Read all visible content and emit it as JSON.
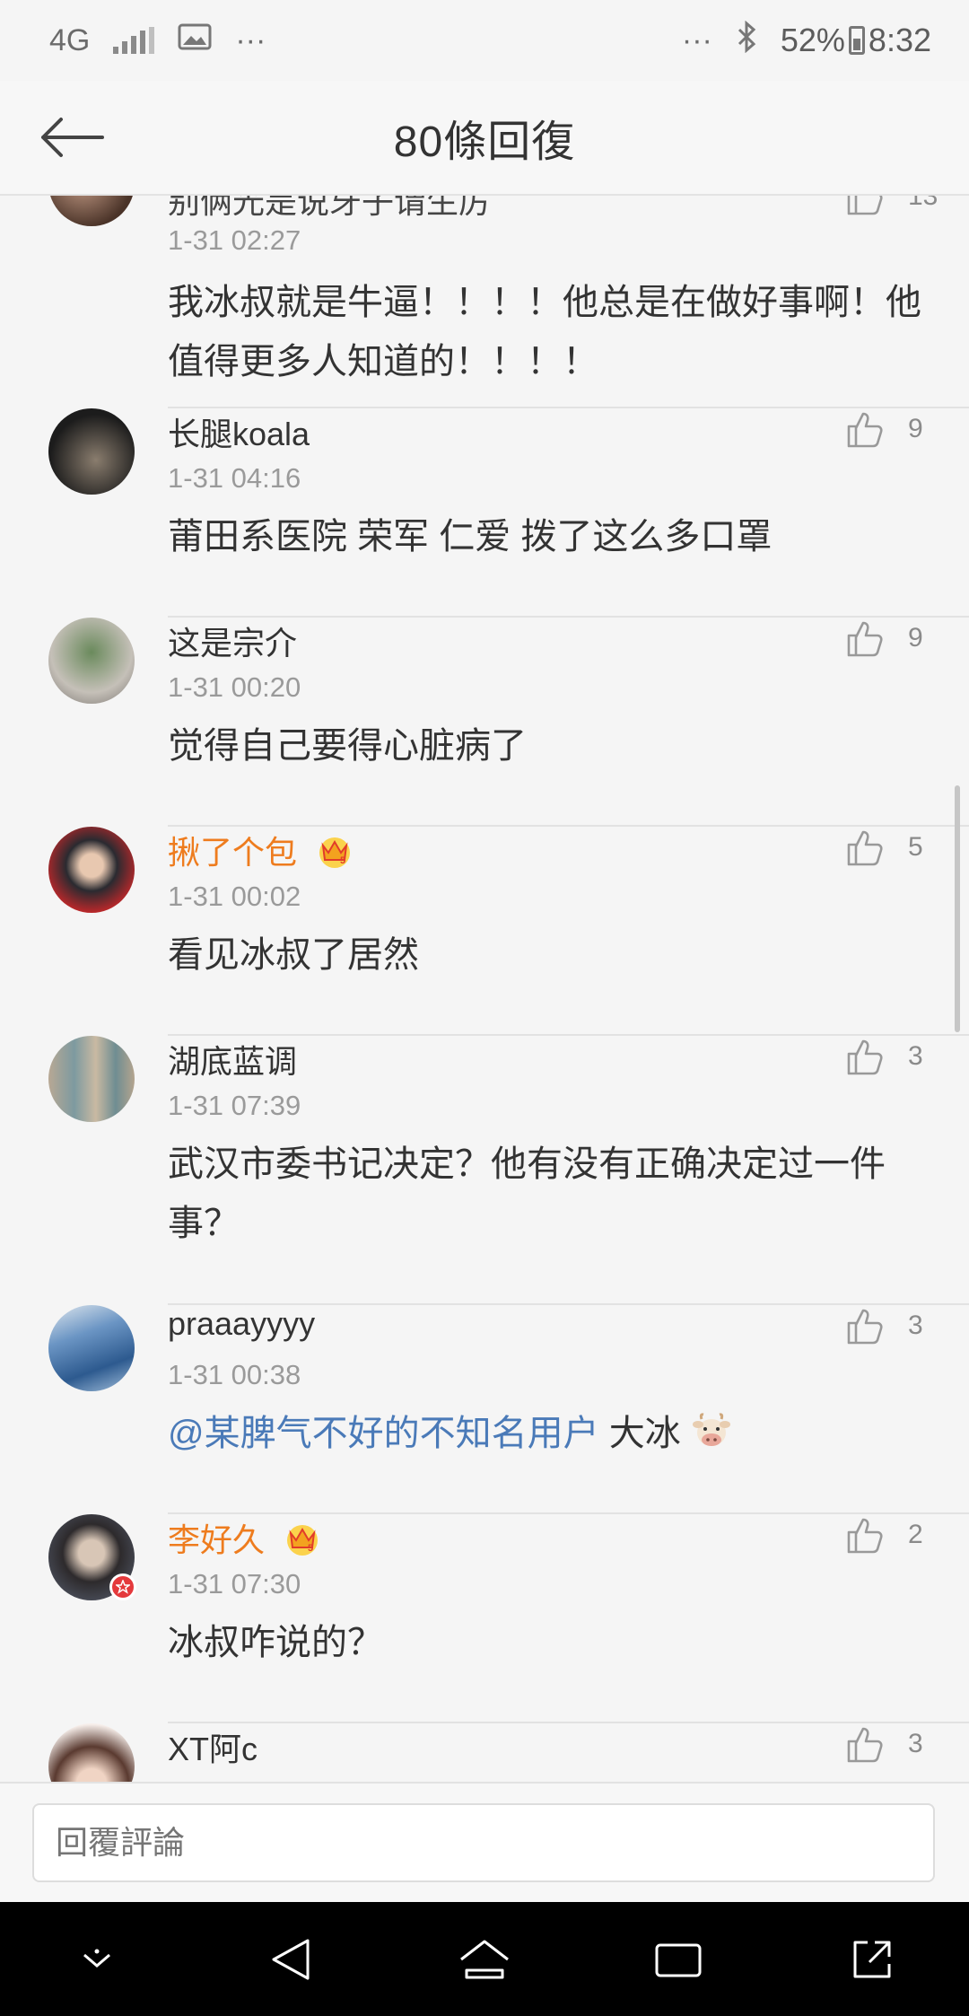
{
  "status_bar": {
    "network": "4G",
    "extra": "···",
    "extra_right": "···",
    "battery": "52%",
    "time": "8:32"
  },
  "header": {
    "title": "80條回復",
    "back_icon": "back-arrow-icon"
  },
  "comments": [
    {
      "name": "",
      "time": "1-31 02:27",
      "text": "我冰叔就是牛逼！！！！他总是在做好事啊！他值得更多人知道的！！！！",
      "likes": "",
      "vip": false
    },
    {
      "name": "长腿koala",
      "time": "1-31 04:16",
      "text": "莆田系医院 荣军 仁爱 拨了这么多口罩",
      "likes": "9",
      "vip": false
    },
    {
      "name": "这是宗介",
      "time": "1-31 00:20",
      "text": "觉得自己要得心脏病了",
      "likes": "9",
      "vip": false
    },
    {
      "name": "揪了个包",
      "time": "1-31 00:02",
      "text": "看见冰叔了居然",
      "likes": "5",
      "vip": true
    },
    {
      "name": "湖底蓝调",
      "time": "1-31 07:39",
      "text": "武汉市委书记决定？他有没有正确决定过一件事？",
      "likes": "3",
      "vip": false
    },
    {
      "name": "praaayyyy",
      "time": "1-31 00:38",
      "mention": "@某脾气不好的不知名用户",
      "text": " 大冰",
      "likes": "3",
      "vip": false
    },
    {
      "name": "李好久",
      "time": "1-31 07:30",
      "text": "冰叔咋说的？",
      "likes": "2",
      "vip": true
    },
    {
      "name": "XT阿c",
      "time": "",
      "text": "",
      "likes": "3",
      "vip": false
    }
  ],
  "reply": {
    "placeholder": "回覆評論"
  },
  "colors": {
    "vip_name": "#ee7c1e",
    "mention": "#4a7ab8",
    "background": "#f5f5f5"
  }
}
